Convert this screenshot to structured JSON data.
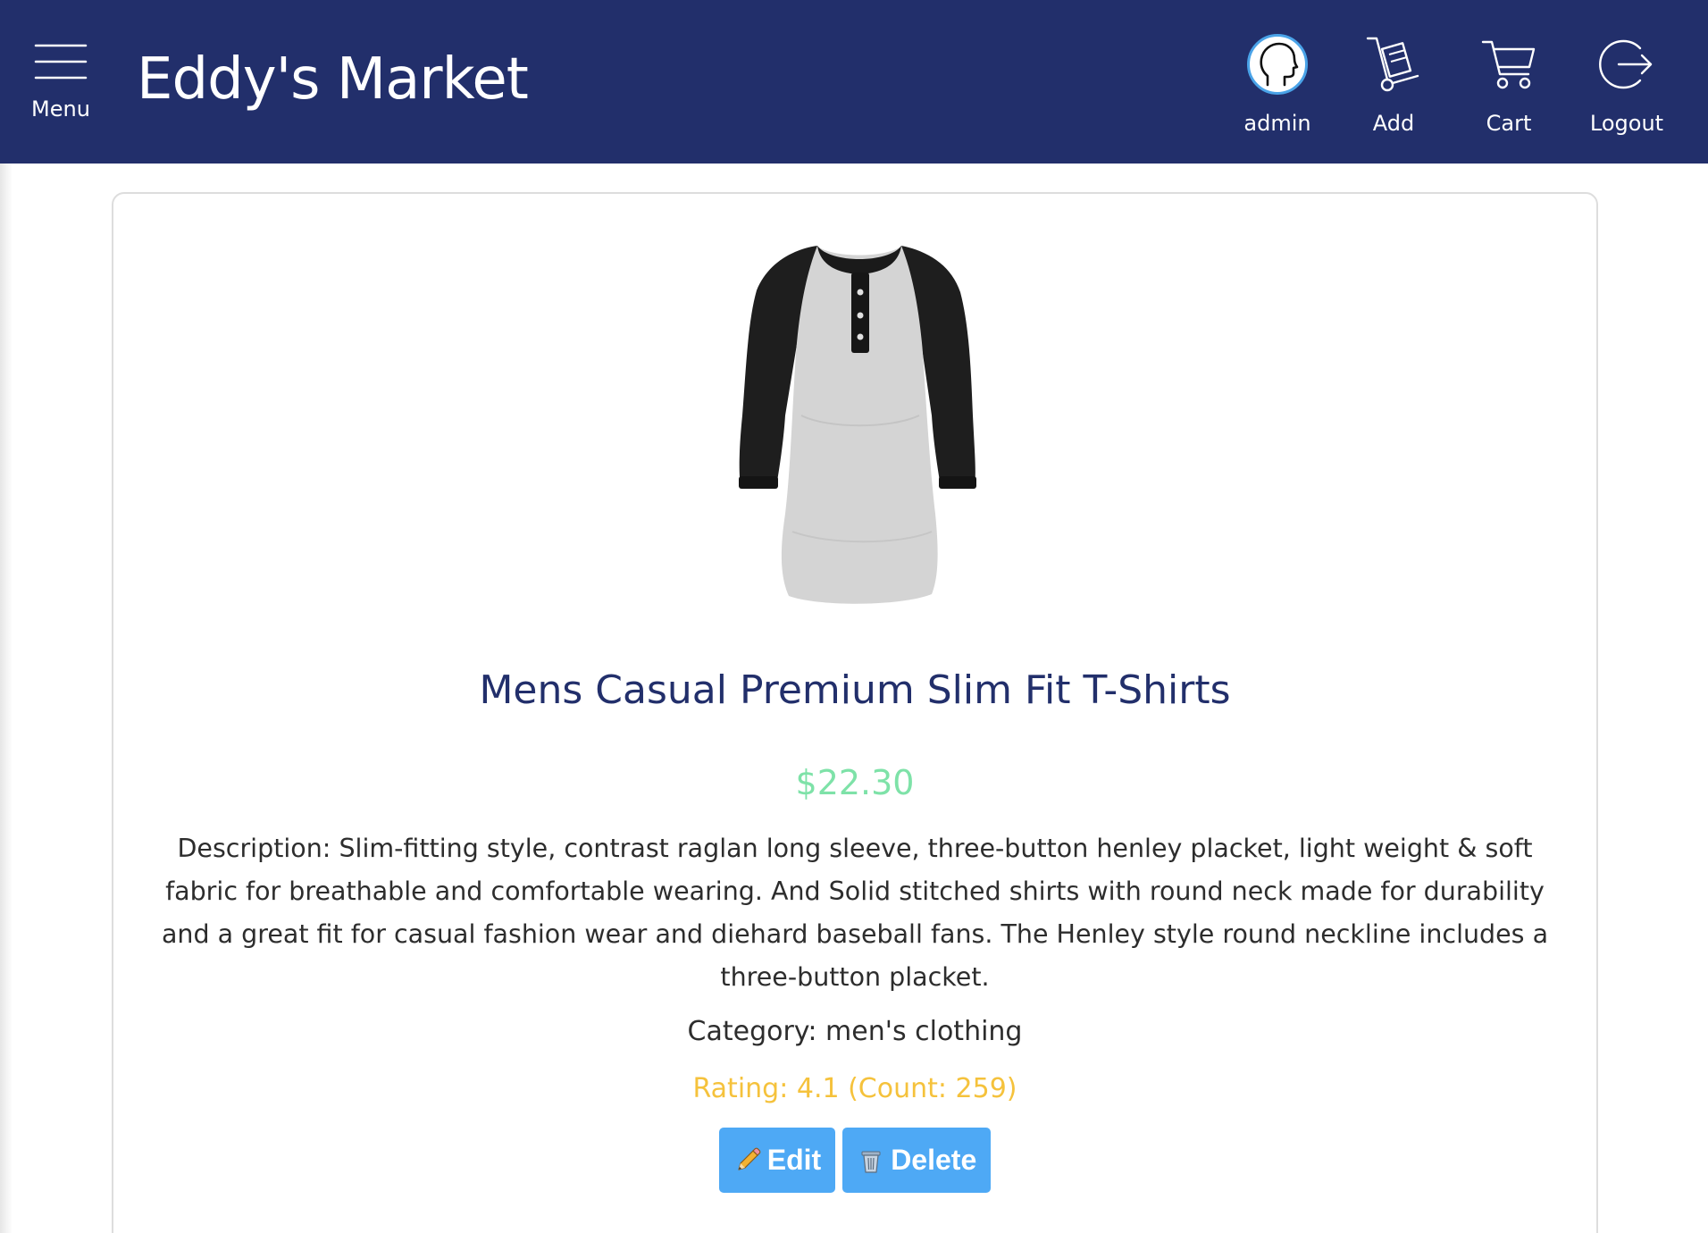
{
  "header": {
    "menu_label": "Menu",
    "brand": "Eddy's Market",
    "nav": {
      "admin": "admin",
      "add": "Add",
      "cart": "Cart",
      "logout": "Logout"
    },
    "colors": {
      "background": "#222f6b",
      "text": "#ffffff",
      "avatar_ring": "#4aa3e8"
    },
    "icons": {
      "menu": "hamburger-icon",
      "admin": "user-avatar-icon",
      "add": "hand-truck-icon",
      "cart": "shopping-cart-icon",
      "logout": "logout-icon"
    }
  },
  "product": {
    "image_alt": "Mens Casual Premium Slim Fit T-Shirts",
    "title": "Mens Casual Premium Slim Fit T-Shirts",
    "price": "$22.30",
    "description": "Description: Slim-fitting style, contrast raglan long sleeve, three-button henley placket, light weight & soft fabric for breathable and comfortable wearing. And Solid stitched shirts with round neck made for durability and a great fit for casual fashion wear and diehard baseball fans. The Henley style round neckline includes a three-button placket.",
    "category": "Category: men's clothing",
    "rating": "Rating: 4.1 (Count: 259)",
    "colors": {
      "title": "#222f6b",
      "price": "#7ee2a8",
      "rating": "#f5c23c",
      "button": "#4ea9f5"
    }
  },
  "actions": {
    "edit_label": "Edit",
    "delete_label": "Delete",
    "edit_icon": "pencil-icon",
    "delete_icon": "trash-icon"
  }
}
